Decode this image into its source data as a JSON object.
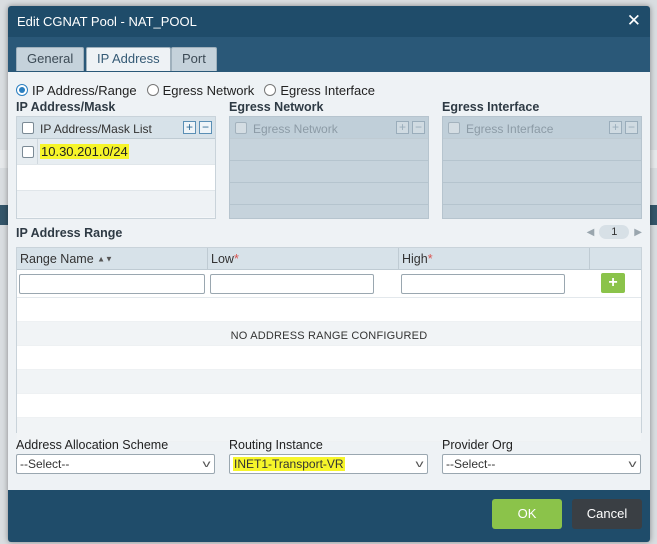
{
  "dialog": {
    "title": "Edit CGNAT Pool - NAT_POOL",
    "close_glyph": "✕"
  },
  "tabs": [
    {
      "label": "General",
      "active": false
    },
    {
      "label": "IP Address",
      "active": true
    },
    {
      "label": "Port",
      "active": false
    }
  ],
  "radios": [
    {
      "label": "IP Address/Range",
      "checked": true
    },
    {
      "label": "Egress Network",
      "checked": false
    },
    {
      "label": "Egress Interface",
      "checked": false
    }
  ],
  "ip_mask": {
    "section_label": "IP Address/Mask",
    "column_header": "IP Address/Mask List",
    "add_glyph": "+",
    "remove_glyph": "−",
    "rows": [
      "10.30.201.0/24"
    ]
  },
  "egress_network": {
    "section_label": "Egress Network",
    "column_header": "Egress Network"
  },
  "egress_interface": {
    "section_label": "Egress Interface",
    "column_header": "Egress Interface"
  },
  "range": {
    "section_label": "IP Address Range",
    "page": "1",
    "columns": {
      "name": "Range Name",
      "low": "Low",
      "high": "High",
      "required_mark": "*"
    },
    "add_glyph": "+",
    "empty_message": "NO ADDRESS RANGE CONFIGURED"
  },
  "fields": {
    "allocation": {
      "label": "Address Allocation Scheme",
      "value": "--Select--"
    },
    "routing": {
      "label": "Routing Instance",
      "value": "INET1-Transport-VR"
    },
    "provider": {
      "label": "Provider Org",
      "value": "--Select--"
    }
  },
  "footer": {
    "ok_label": "OK",
    "cancel_label": "Cancel"
  },
  "colors": {
    "titlebar": "#1f4c6a",
    "accent_green": "#8bc34a",
    "highlight": "#f6f52a"
  }
}
